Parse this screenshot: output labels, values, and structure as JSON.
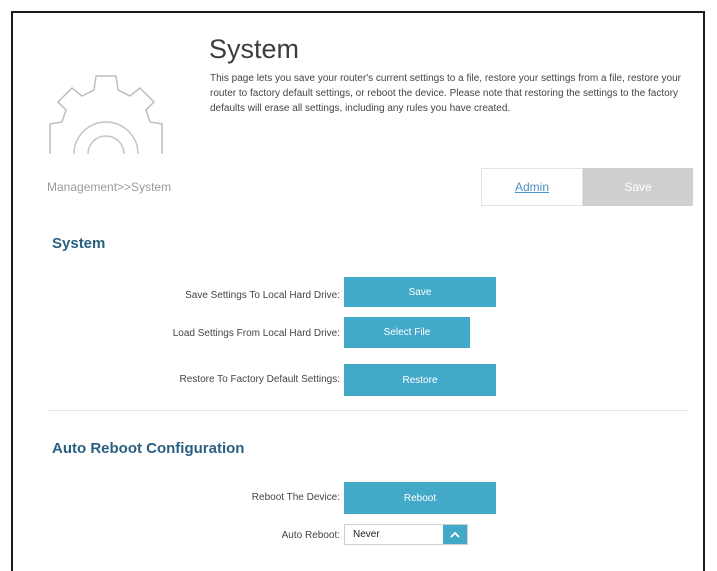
{
  "page": {
    "title": "System",
    "description": "This page lets you save your router's current settings to a file, restore your settings from a file, restore your router to factory default settings, or reboot the device. Please note that restoring the settings to the factory defaults will erase all settings, including any rules you have created."
  },
  "breadcrumb": "Management>>System",
  "top_actions": {
    "admin_label": "Admin",
    "save_label": "Save"
  },
  "system_section": {
    "title": "System",
    "rows": [
      {
        "label": "Save Settings To Local Hard Drive:",
        "button": "Save"
      },
      {
        "label": "Load Settings From Local Hard Drive:",
        "button": "Select File"
      },
      {
        "label": "Restore To Factory Default Settings:",
        "button": "Restore"
      }
    ]
  },
  "auto_reboot_section": {
    "title": "Auto Reboot Configuration",
    "reboot_label": "Reboot The Device:",
    "reboot_button": "Reboot",
    "auto_reboot_label": "Auto Reboot:",
    "auto_reboot_value": "Never"
  },
  "colors": {
    "accent": "#42a9c8",
    "heading": "#2a5f82",
    "link": "#4a90c2",
    "disabled": "#cfcfcf"
  },
  "icons": {
    "header": "gear-icon",
    "select_arrow": "chevron-up-icon"
  }
}
